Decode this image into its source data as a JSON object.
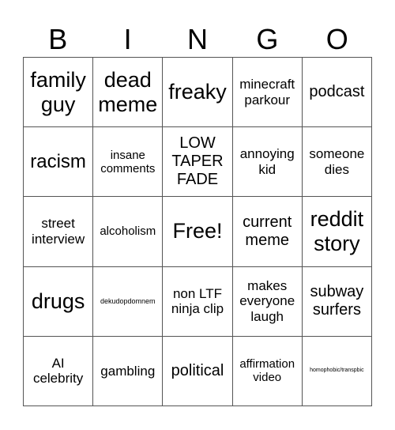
{
  "header": {
    "letters": [
      "B",
      "I",
      "N",
      "G",
      "O"
    ]
  },
  "cells": [
    [
      "family guy",
      "dead meme",
      "freaky",
      "minecraft parkour",
      "podcast"
    ],
    [
      "racism",
      "insane comments",
      "LOW TAPER FADE",
      "annoying kid",
      "someone dies"
    ],
    [
      "street interview",
      "alcoholism",
      "Free!",
      "current meme",
      "reddit story"
    ],
    [
      "drugs",
      "dekudopdomnem",
      "non LTF ninja clip",
      "makes everyone laugh",
      "subway surfers"
    ],
    [
      "AI celebrity",
      "gambling",
      "political",
      "affirmation video",
      "homophobic/transpbic"
    ]
  ]
}
